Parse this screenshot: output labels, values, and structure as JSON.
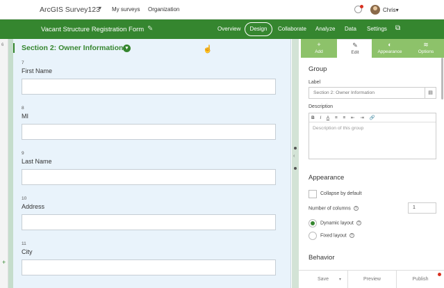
{
  "topbar": {
    "brand": "ArcGIS Survey123",
    "brand_caret": "▾",
    "nav": [
      "My surveys",
      "Organization"
    ],
    "user": "Chris▾"
  },
  "greenbar": {
    "form_title": "Vacant Structure Registration Form",
    "tabs": [
      "Overview",
      "Design",
      "Collaborate",
      "Analyze",
      "Data",
      "Settings"
    ],
    "active_tab": "Design"
  },
  "leftrail": {
    "marker": "6"
  },
  "form": {
    "section_title": "Section 2: Owner Information",
    "questions": [
      {
        "num": "7",
        "label": "First Name"
      },
      {
        "num": "8",
        "label": "MI"
      },
      {
        "num": "9",
        "label": "Last Name"
      },
      {
        "num": "10",
        "label": "Address"
      },
      {
        "num": "11",
        "label": "City"
      }
    ]
  },
  "panel": {
    "tabs": [
      {
        "label": "Add",
        "icon": "plus-icon"
      },
      {
        "label": "Edit",
        "icon": "pencil-icon"
      },
      {
        "label": "Appearance",
        "icon": "palette-icon"
      },
      {
        "label": "Options",
        "icon": "sliders-icon"
      }
    ],
    "active_tab": "Edit",
    "group_heading": "Group",
    "label_caption": "Label",
    "label_value": "Section 2: Owner Information",
    "description_caption": "Description",
    "toolbar": [
      "B",
      "I",
      "A",
      "≡",
      "≡",
      "⇤",
      "⇥",
      "🔗"
    ],
    "description_placeholder": "Description of this group",
    "appearance_heading": "Appearance",
    "collapse_label": "Collapse by default",
    "columns_label": "Number of columns",
    "columns_value": "1",
    "layout_options": [
      "Dynamic layout",
      "Fixed layout"
    ],
    "selected_layout": "Dynamic layout",
    "behavior_heading": "Behavior",
    "footer": {
      "save": "Save",
      "save_caret": "▾",
      "preview": "Preview",
      "publish": "Publish"
    }
  },
  "colors": {
    "brand_green": "#35862f",
    "tab_green": "#8dc26a",
    "form_bg": "#e9f3fb",
    "alert_red": "#d83020"
  }
}
